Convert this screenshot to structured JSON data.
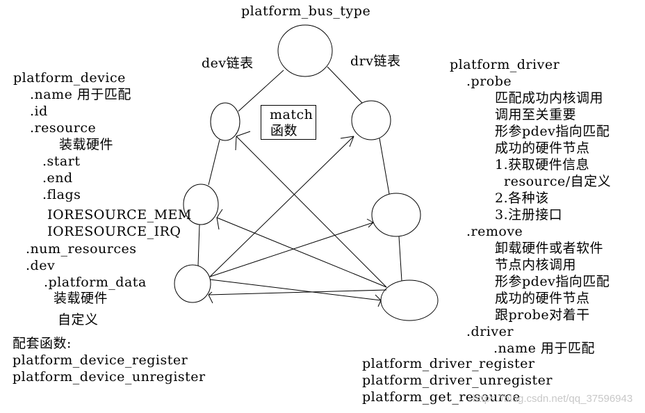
{
  "diagram": {
    "bus_title": "platform_bus_type",
    "dev_list_label": "dev链表",
    "drv_list_label": "drv链表",
    "match_box": [
      "match",
      "函数"
    ]
  },
  "device": {
    "title": "platform_device",
    "lines": [
      ".name 用于匹配",
      ".id",
      ".resource",
      "装载硬件",
      ".start",
      ".end",
      ".flags",
      "IORESOURCE_MEM",
      "IORESOURCE_IRQ",
      ".num_resources",
      ".dev",
      ".platform_data",
      "装载硬件",
      "自定义"
    ],
    "funcs_title": "配套函数:",
    "funcs": [
      "platform_device_register",
      "platform_device_unregister"
    ]
  },
  "driver": {
    "title": "platform_driver",
    "lines": [
      ".probe",
      "匹配成功内核调用",
      "调用至关重要",
      "形参pdev指向匹配",
      "成功的硬件节点",
      "1.获取硬件信息",
      "resource/自定义",
      "2.各种该",
      "3.注册接口",
      ".remove",
      "卸载硬件或者软件",
      "节点内核调用",
      "形参pdev指向匹配",
      "成功的硬件节点",
      "跟probe对着干",
      ".driver",
      ".name 用于匹配"
    ],
    "funcs": [
      "platform_driver_register",
      "platform_driver_unregister",
      "platform_get_resource"
    ]
  },
  "watermark": "https://blog.csdn.net/qq_37596943"
}
